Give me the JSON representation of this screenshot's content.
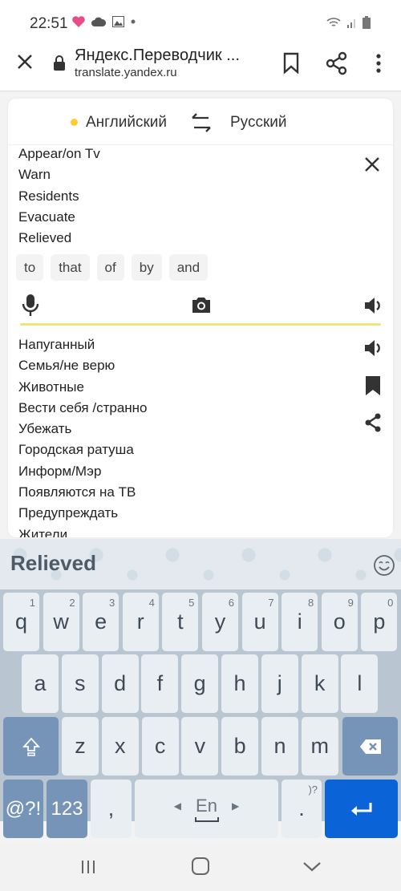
{
  "statusbar": {
    "time": "22:51"
  },
  "browser": {
    "title": "Яндекс.Переводчик ...",
    "url": "translate.yandex.ru"
  },
  "translator": {
    "source_lang": "Английский",
    "target_lang": "Русский",
    "accent_color": "#ffcc33",
    "source_lines": [
      "Appear/on Tv",
      "Warn",
      "Residents",
      "Evacuate",
      "Relieved"
    ],
    "chips": [
      "to",
      "that",
      "of",
      "by",
      "and"
    ],
    "target_lines": [
      "Напуганный",
      "Семья/не верю",
      "Животные",
      "Вести себя /странно",
      "Убежать",
      "Городская ратуша",
      "Информ/Мэр",
      "Появляются на ТВ",
      "Предупреждать",
      "Жители"
    ]
  },
  "keyboard": {
    "suggestion": "Relieved",
    "row1": [
      {
        "k": "q",
        "n": "1"
      },
      {
        "k": "w",
        "n": "2"
      },
      {
        "k": "e",
        "n": "3"
      },
      {
        "k": "r",
        "n": "4"
      },
      {
        "k": "t",
        "n": "5"
      },
      {
        "k": "y",
        "n": "6"
      },
      {
        "k": "u",
        "n": "7"
      },
      {
        "k": "i",
        "n": "8"
      },
      {
        "k": "o",
        "n": "9"
      },
      {
        "k": "p",
        "n": "0"
      }
    ],
    "row2": [
      "a",
      "s",
      "d",
      "f",
      "g",
      "h",
      "j",
      "k",
      "l"
    ],
    "row3": [
      "z",
      "x",
      "c",
      "v",
      "b",
      "n",
      "m"
    ],
    "symbols_label": "@?!",
    "numbers_label": "123",
    "comma": ",",
    "space_label": "En",
    "period": ".",
    "period_hint": ")?",
    "enter_color": "#0b63d8"
  }
}
